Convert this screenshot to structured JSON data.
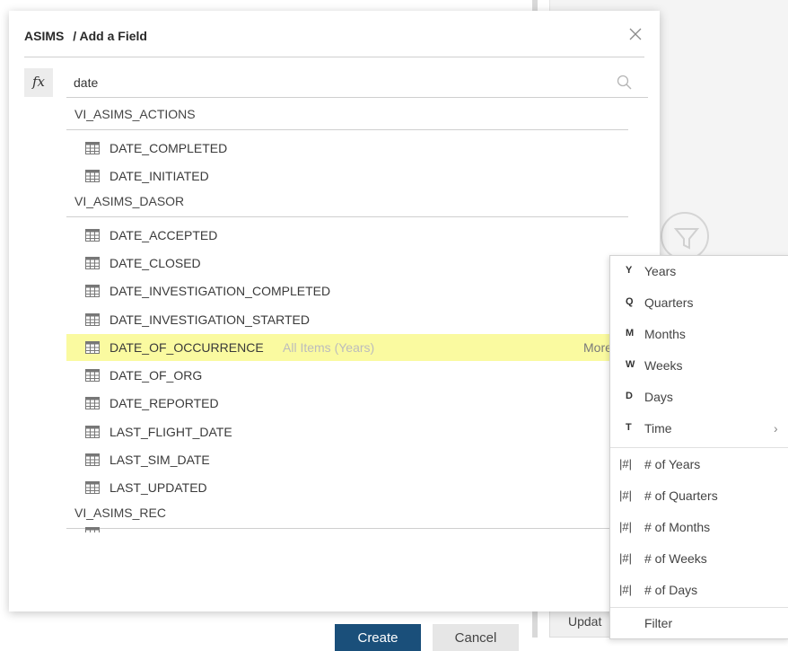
{
  "dialog": {
    "title_app": "ASIMS",
    "title_page": "/ Add a Field",
    "fx_label": "fx"
  },
  "search": {
    "value": "date"
  },
  "groups": [
    {
      "label": "VI_ASIMS_ACTIONS",
      "fields": [
        {
          "name": "DATE_COMPLETED"
        },
        {
          "name": "DATE_INITIATED"
        }
      ]
    },
    {
      "label": "VI_ASIMS_DASOR",
      "fields": [
        {
          "name": "DATE_ACCEPTED"
        },
        {
          "name": "DATE_CLOSED"
        },
        {
          "name": "DATE_INVESTIGATION_COMPLETED"
        },
        {
          "name": "DATE_INVESTIGATION_STARTED"
        },
        {
          "name": "DATE_OF_OCCURRENCE",
          "sub": "All Items (Years)",
          "more": "More"
        },
        {
          "name": "DATE_OF_ORG"
        },
        {
          "name": "DATE_REPORTED"
        },
        {
          "name": "LAST_FLIGHT_DATE"
        },
        {
          "name": "LAST_SIM_DATE"
        },
        {
          "name": "LAST_UPDATED"
        }
      ]
    },
    {
      "label": "VI_ASIMS_REC",
      "fields": []
    }
  ],
  "buttons": {
    "create": "Create",
    "cancel": "Cancel"
  },
  "background": {
    "update_label": "Updat"
  },
  "menu": {
    "date_parts": [
      {
        "key": "Y",
        "label": "Years"
      },
      {
        "key": "Q",
        "label": "Quarters"
      },
      {
        "key": "M",
        "label": "Months"
      },
      {
        "key": "W",
        "label": "Weeks"
      },
      {
        "key": "D",
        "label": "Days"
      },
      {
        "key": "T",
        "label": "Time",
        "chevron": "›"
      }
    ],
    "counts": [
      {
        "key": "|#|",
        "label": "# of Years"
      },
      {
        "key": "|#|",
        "label": "# of Quarters"
      },
      {
        "key": "|#|",
        "label": "# of Months"
      },
      {
        "key": "|#|",
        "label": "# of Weeks"
      },
      {
        "key": "|#|",
        "label": "# of Days"
      }
    ],
    "filter_label": "Filter"
  },
  "colors": {
    "highlight": "#fafaa0",
    "primary_button": "#1a4f7a"
  },
  "icons": {
    "field": "table-icon",
    "close": "close-icon",
    "search": "search-icon",
    "funnel": "filter-funnel-icon"
  }
}
